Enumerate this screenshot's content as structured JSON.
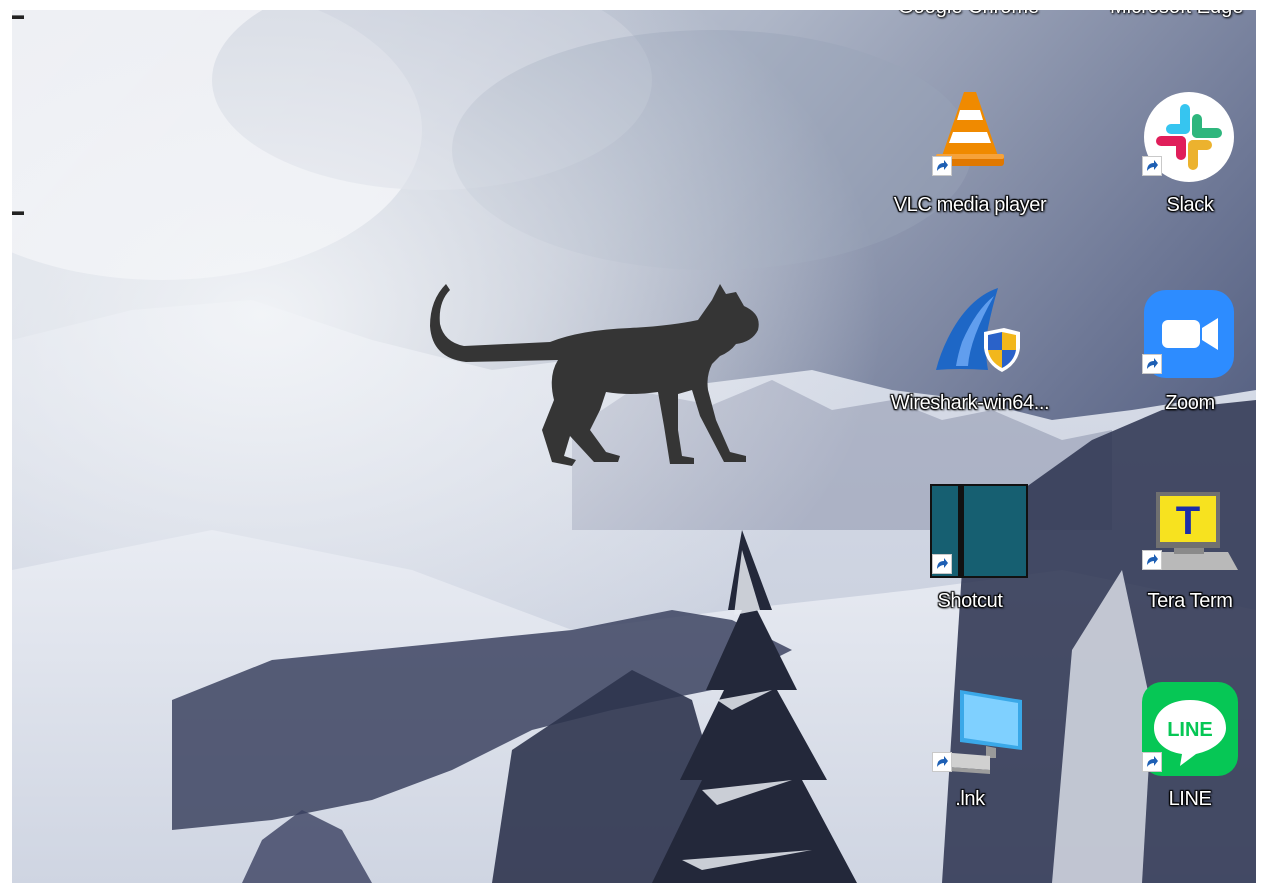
{
  "desktop": {
    "top_row": [
      {
        "label": "Google Chrome"
      },
      {
        "label": "Microsoft Edge"
      }
    ],
    "icons": [
      {
        "label": "VLC media player",
        "icon": "vlc-cone-icon"
      },
      {
        "label": "Slack",
        "icon": "slack-icon"
      },
      {
        "label": "Wireshark-win64...",
        "icon": "wireshark-fin-icon"
      },
      {
        "label": "Zoom",
        "icon": "zoom-camera-icon"
      },
      {
        "label": "Shotcut",
        "icon": "shotcut-icon"
      },
      {
        "label": "Tera Term",
        "icon": "teraterm-icon"
      },
      {
        "label": ".lnk",
        "icon": "computer-monitor-icon"
      },
      {
        "label": "LINE",
        "icon": "line-icon"
      }
    ],
    "overlay": {
      "icon": "cat-silhouette-icon"
    }
  },
  "colors": {
    "label_text": "#ffffff",
    "vlc_orange": "#f08a00",
    "zoom_blue": "#2d8cff",
    "line_green": "#06c755",
    "shotcut_teal": "#155e70",
    "cat": "#353535"
  }
}
